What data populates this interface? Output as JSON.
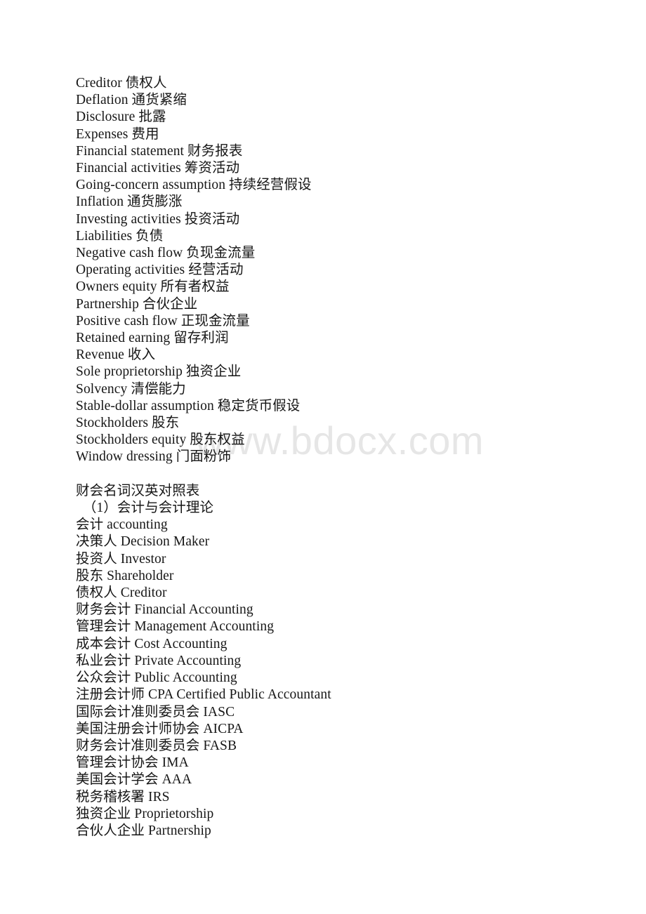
{
  "document": {
    "watermark": "www.bdocx.com",
    "section_english_chinese": {
      "lines": [
        "Creditor 债权人",
        "Deflation 通货紧缩",
        "Disclosure 批露",
        "Expenses 费用",
        "Financial statement 财务报表",
        "Financial activities 筹资活动",
        "Going-concern assumption 持续经营假设",
        "Inflation 通货膨涨",
        "Investing activities 投资活动",
        "Liabilities 负债",
        "Negative cash flow 负现金流量",
        "Operating activities 经营活动",
        "Owners equity 所有者权益",
        "Partnership 合伙企业",
        "Positive cash flow 正现金流量",
        "Retained earning 留存利润",
        "Revenue 收入",
        "Sole proprietorship 独资企业",
        "Solvency 清偿能力",
        "Stable-dollar assumption 稳定货币假设",
        "Stockholders 股东",
        "Stockholders equity 股东权益",
        "Window dressing 门面粉饰"
      ]
    },
    "section_chinese_english": {
      "title": "财会名词汉英对照表",
      "subtitle": "　（1）会计与会计理论",
      "lines": [
        "会计 accounting",
        "决策人 Decision Maker",
        "投资人 Investor",
        "股东 Shareholder",
        "债权人 Creditor",
        "财务会计 Financial Accounting",
        "管理会计 Management Accounting",
        "成本会计 Cost Accounting",
        "私业会计 Private Accounting",
        "公众会计 Public Accounting",
        "注册会计师 CPA Certified Public Accountant",
        "国际会计准则委员会 IASC",
        "美国注册会计师协会 AICPA",
        "财务会计准则委员会 FASB",
        "管理会计协会 IMA",
        "美国会计学会 AAA",
        "税务稽核署 IRS",
        "独资企业 Proprietorship",
        "合伙人企业 Partnership"
      ]
    }
  }
}
